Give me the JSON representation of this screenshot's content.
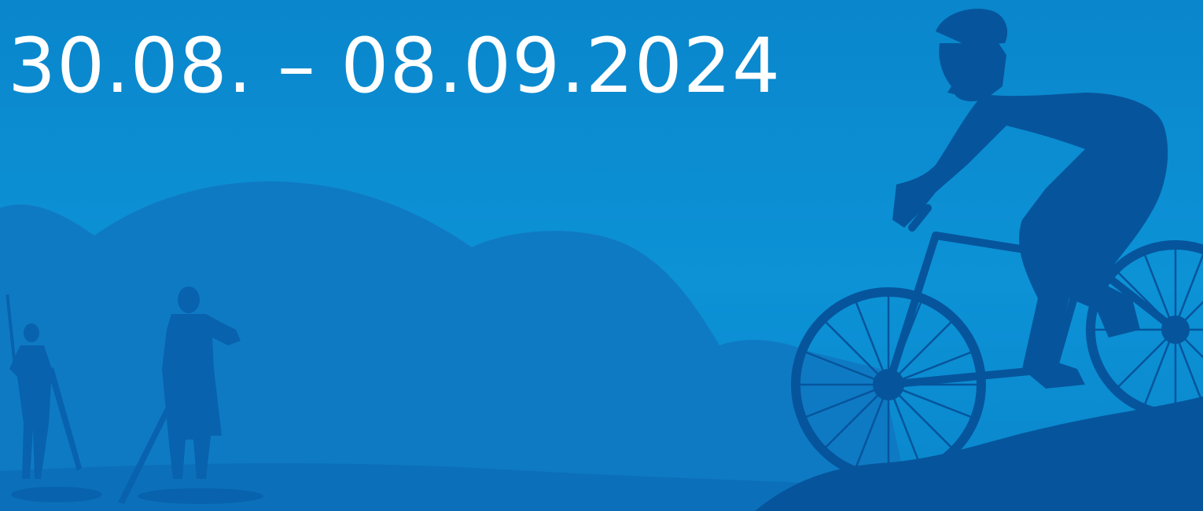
{
  "banner": {
    "date_range": "30.08. – 08.09.2024",
    "background_color": "#0a88cf",
    "silhouette_colors": {
      "far_hills": "#0f7ac4",
      "near_hills": "#0b70b9",
      "figures": "#0862ad",
      "cyclist": "#06559c"
    },
    "illustration": [
      "paddleboarder-silhouette",
      "paddleboarder-silhouette",
      "mountain-biker-silhouette"
    ]
  }
}
